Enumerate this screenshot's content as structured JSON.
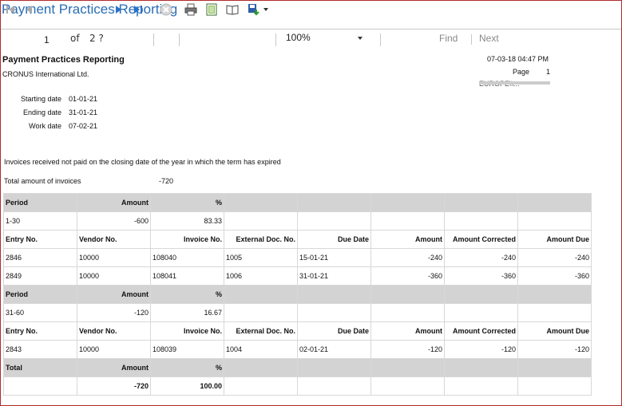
{
  "app": {
    "title": "Payment Practices Reporting"
  },
  "toolbar": {
    "page_current": "1",
    "of_label": "of",
    "page_total": "2 ?",
    "zoom": "100%",
    "find_label": "Find",
    "next_label": "Next"
  },
  "report": {
    "title": "Payment Practices Reporting",
    "company": "CRONUS International Ltd.",
    "printed_at": "07-03-18 04:47 PM",
    "page_label": "Page",
    "page_number": "1",
    "user": "EUROPE\\\\...",
    "starting_date_label": "Starting date",
    "starting_date": "01-01-21",
    "ending_date_label": "Ending date",
    "ending_date": "31-01-21",
    "work_date_label": "Work date",
    "work_date": "07-02-21",
    "description": "Invoices received not paid on the closing date of the year in which the term has expired",
    "total_amount_label": "Total amount of invoices",
    "total_amount": "-720",
    "col_headers": {
      "period": "Period",
      "amount": "Amount",
      "percent": "%",
      "entry_no": "Entry No.",
      "vendor_no": "Vendor No.",
      "invoice_no": "Invoice No.",
      "external_doc_no": "External Doc. No.",
      "due_date": "Due Date",
      "amount_corrected": "Amount Corrected",
      "amount_due": "Amount Due",
      "total": "Total"
    },
    "groups": [
      {
        "period": "1-30",
        "amount": "-600",
        "percent": "83.33",
        "entries": [
          {
            "entry_no": "2846",
            "vendor_no": "10000",
            "invoice_no": "108040",
            "external_doc_no": "1005",
            "due_date": "15-01-21",
            "amount": "-240",
            "amount_corrected": "-240",
            "amount_due": "-240"
          },
          {
            "entry_no": "2849",
            "vendor_no": "10000",
            "invoice_no": "108041",
            "external_doc_no": "1006",
            "due_date": "31-01-21",
            "amount": "-360",
            "amount_corrected": "-360",
            "amount_due": "-360"
          }
        ]
      },
      {
        "period": "31-60",
        "amount": "-120",
        "percent": "16.67",
        "entries": [
          {
            "entry_no": "2843",
            "vendor_no": "10000",
            "invoice_no": "108039",
            "external_doc_no": "1004",
            "due_date": "02-01-21",
            "amount": "-120",
            "amount_corrected": "-120",
            "amount_due": "-120"
          }
        ]
      }
    ],
    "total": {
      "amount": "-720",
      "percent": "100.00"
    }
  }
}
